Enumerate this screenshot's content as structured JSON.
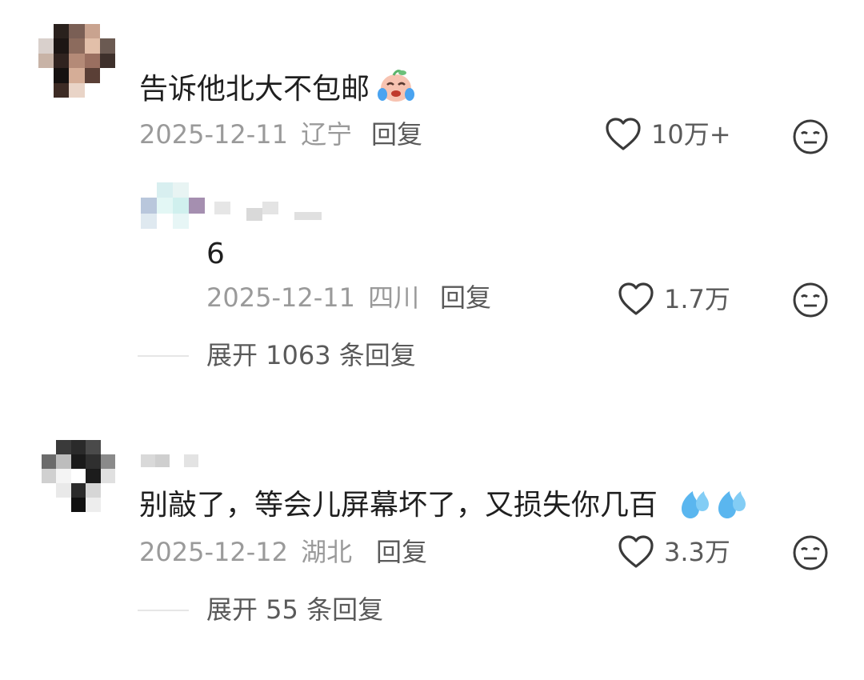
{
  "comments": [
    {
      "text": "告诉他北大不包邮",
      "date": "2025-12-11",
      "region": "辽宁",
      "reply_label": "回复",
      "likes": "10万+",
      "reply": {
        "text": "6",
        "date": "2025-12-11",
        "region": "四川",
        "reply_label": "回复",
        "likes": "1.7万"
      },
      "expand_label": "展开 1063 条回复"
    },
    {
      "text": "别敲了，等会儿屏幕坏了，又损失你几百",
      "date": "2025-12-12",
      "region": "湖北",
      "reply_label": "回复",
      "likes": "3.3万",
      "expand_label": "展开 55 条回复"
    }
  ],
  "icons": {
    "like": "heart-outline-icon",
    "dislike": "neutral-face-icon",
    "emoji_crying": "crying-face-emoji",
    "emoji_sweat": "sweat-droplets-emoji"
  }
}
